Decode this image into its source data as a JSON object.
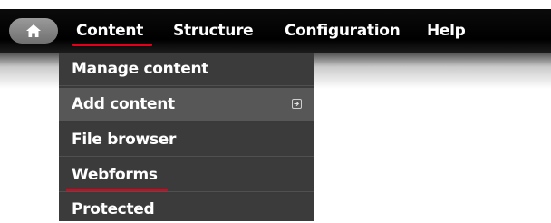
{
  "toolbar": {
    "home_icon": "home-icon",
    "menu": [
      {
        "label": "Content"
      },
      {
        "label": "Structure"
      },
      {
        "label": "Configuration"
      },
      {
        "label": "Help"
      }
    ],
    "active_item": "Content"
  },
  "dropdown": {
    "items": [
      {
        "label": "Manage content"
      },
      {
        "label": "Add content",
        "submenu_icon": "expand-arrow-icon"
      },
      {
        "label": "File browser"
      },
      {
        "label": "Webforms"
      },
      {
        "label": "Protected"
      }
    ]
  },
  "colors": {
    "toolbar_background": "#000000",
    "dropdown_background": "#3b3b3b",
    "hover_background": "#575757",
    "highlight_underline": "#e2001a",
    "text": "#ffffff"
  }
}
